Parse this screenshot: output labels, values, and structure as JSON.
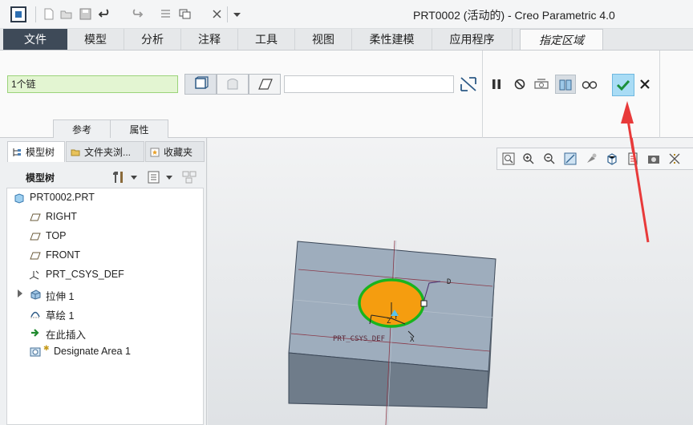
{
  "window": {
    "title": "PRT0002 (活动的) - Creo Parametric 4.0"
  },
  "quick_access": {
    "icons": [
      "new-icon",
      "open-icon",
      "save-icon",
      "undo-icon",
      "redo-icon",
      "regenerate-icon",
      "windows-icon",
      "close-window-icon",
      "customize-icon"
    ]
  },
  "ribbon": {
    "tabs": [
      {
        "label": "文件"
      },
      {
        "label": "模型"
      },
      {
        "label": "分析"
      },
      {
        "label": "注释"
      },
      {
        "label": "工具"
      },
      {
        "label": "视图"
      },
      {
        "label": "柔性建模"
      },
      {
        "label": "应用程序"
      },
      {
        "label": "指定区域"
      }
    ],
    "chain_value": "1个链",
    "panel_tabs": [
      {
        "label": "参考"
      },
      {
        "label": "属性"
      }
    ]
  },
  "navigator": {
    "tabs": [
      {
        "label": "模型树"
      },
      {
        "label": "文件夹浏..."
      },
      {
        "label": "收藏夹"
      }
    ],
    "tree_title": "模型树",
    "items": [
      {
        "label": "PRT0002.PRT",
        "icon": "part-icon"
      },
      {
        "label": "RIGHT",
        "icon": "datum-plane-icon"
      },
      {
        "label": "TOP",
        "icon": "datum-plane-icon"
      },
      {
        "label": "FRONT",
        "icon": "datum-plane-icon"
      },
      {
        "label": "PRT_CSYS_DEF",
        "icon": "csys-icon"
      },
      {
        "label": "拉伸 1",
        "icon": "extrude-icon"
      },
      {
        "label": "草绘 1",
        "icon": "sketch-icon"
      },
      {
        "label": "在此插入",
        "icon": "insert-here-icon"
      },
      {
        "label": "Designate Area 1",
        "icon": "designate-area-icon"
      }
    ]
  },
  "graphics": {
    "labels": {
      "csys": "PRT_CSYS_DEF",
      "x_axis": "X",
      "y_axis": "Y",
      "z_axis": "Z",
      "handle": "D"
    },
    "colors": {
      "region_fill": "#f59d0f",
      "region_outline": "#19b41e",
      "part_top": "#9eadbd",
      "part_side": "#6f7c8a",
      "annotation_arrow": "#e83a3a"
    }
  }
}
